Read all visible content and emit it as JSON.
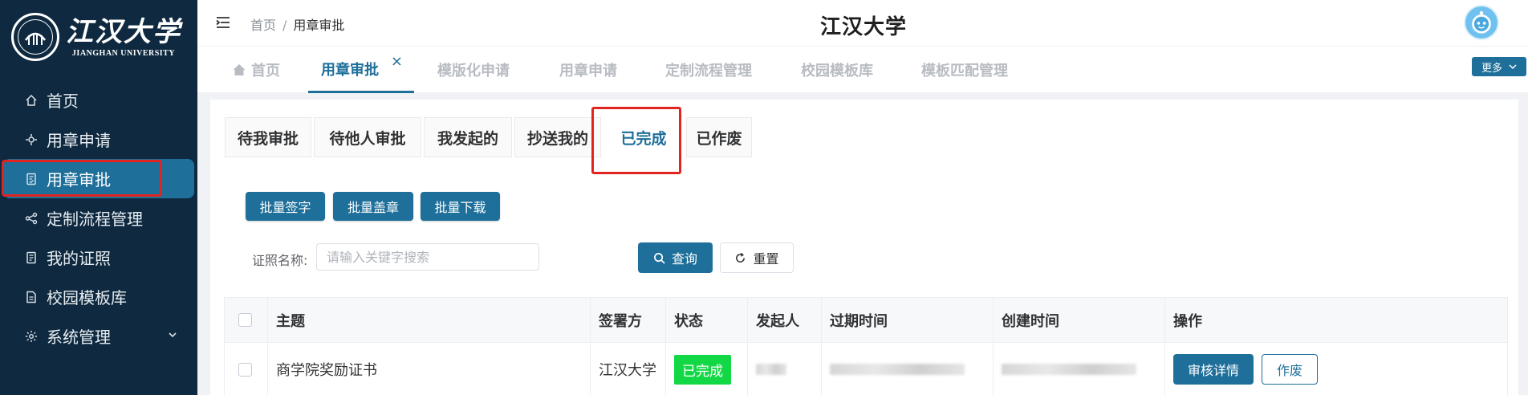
{
  "sidebar": {
    "logo_cn": "江汉大学",
    "logo_en": "JIANGHAN UNIVERSITY",
    "items": [
      {
        "label": "首页",
        "icon": "home-icon"
      },
      {
        "label": "用章申请",
        "icon": "stamp-icon"
      },
      {
        "label": "用章审批",
        "icon": "document-check-icon",
        "active": true
      },
      {
        "label": "定制流程管理",
        "icon": "flow-icon"
      },
      {
        "label": "我的证照",
        "icon": "certificate-icon"
      },
      {
        "label": "校园模板库",
        "icon": "template-icon"
      },
      {
        "label": "系统管理",
        "icon": "gear-icon"
      }
    ]
  },
  "header": {
    "breadcrumb": [
      "首页",
      "用章审批"
    ],
    "breadcrumb_sep": "/",
    "title": "江汉大学"
  },
  "tagbar": {
    "tags": [
      "首页",
      "用章审批",
      "模版化申请",
      "用章申请",
      "定制流程管理",
      "校园模板库",
      "模板匹配管理"
    ],
    "active_close": "×",
    "more": "更多"
  },
  "status_tabs": [
    "待我审批",
    "待他人审批",
    "我发起的",
    "抄送我的",
    "已完成",
    "已作废"
  ],
  "actions": {
    "batch_sign": "批量签字",
    "batch_stamp": "批量盖章",
    "batch_download": "批量下载"
  },
  "filter": {
    "label": "证照名称:",
    "placeholder": "请输入关键字搜索",
    "search": "查询",
    "reset": "重置"
  },
  "table": {
    "columns": [
      "主题",
      "签署方",
      "状态",
      "发起人",
      "过期时间",
      "创建时间",
      "操作"
    ],
    "rows": [
      {
        "subject": "商学院奖励证书",
        "signer": "江汉大学",
        "status": "已完成",
        "detail_btn": "审核详情",
        "void_btn": "作废"
      }
    ]
  },
  "colors": {
    "sidebar_bg": "#0f2a40",
    "accent": "#1e6f9a",
    "status_green": "#13d845",
    "highlight_red": "#e12420"
  }
}
